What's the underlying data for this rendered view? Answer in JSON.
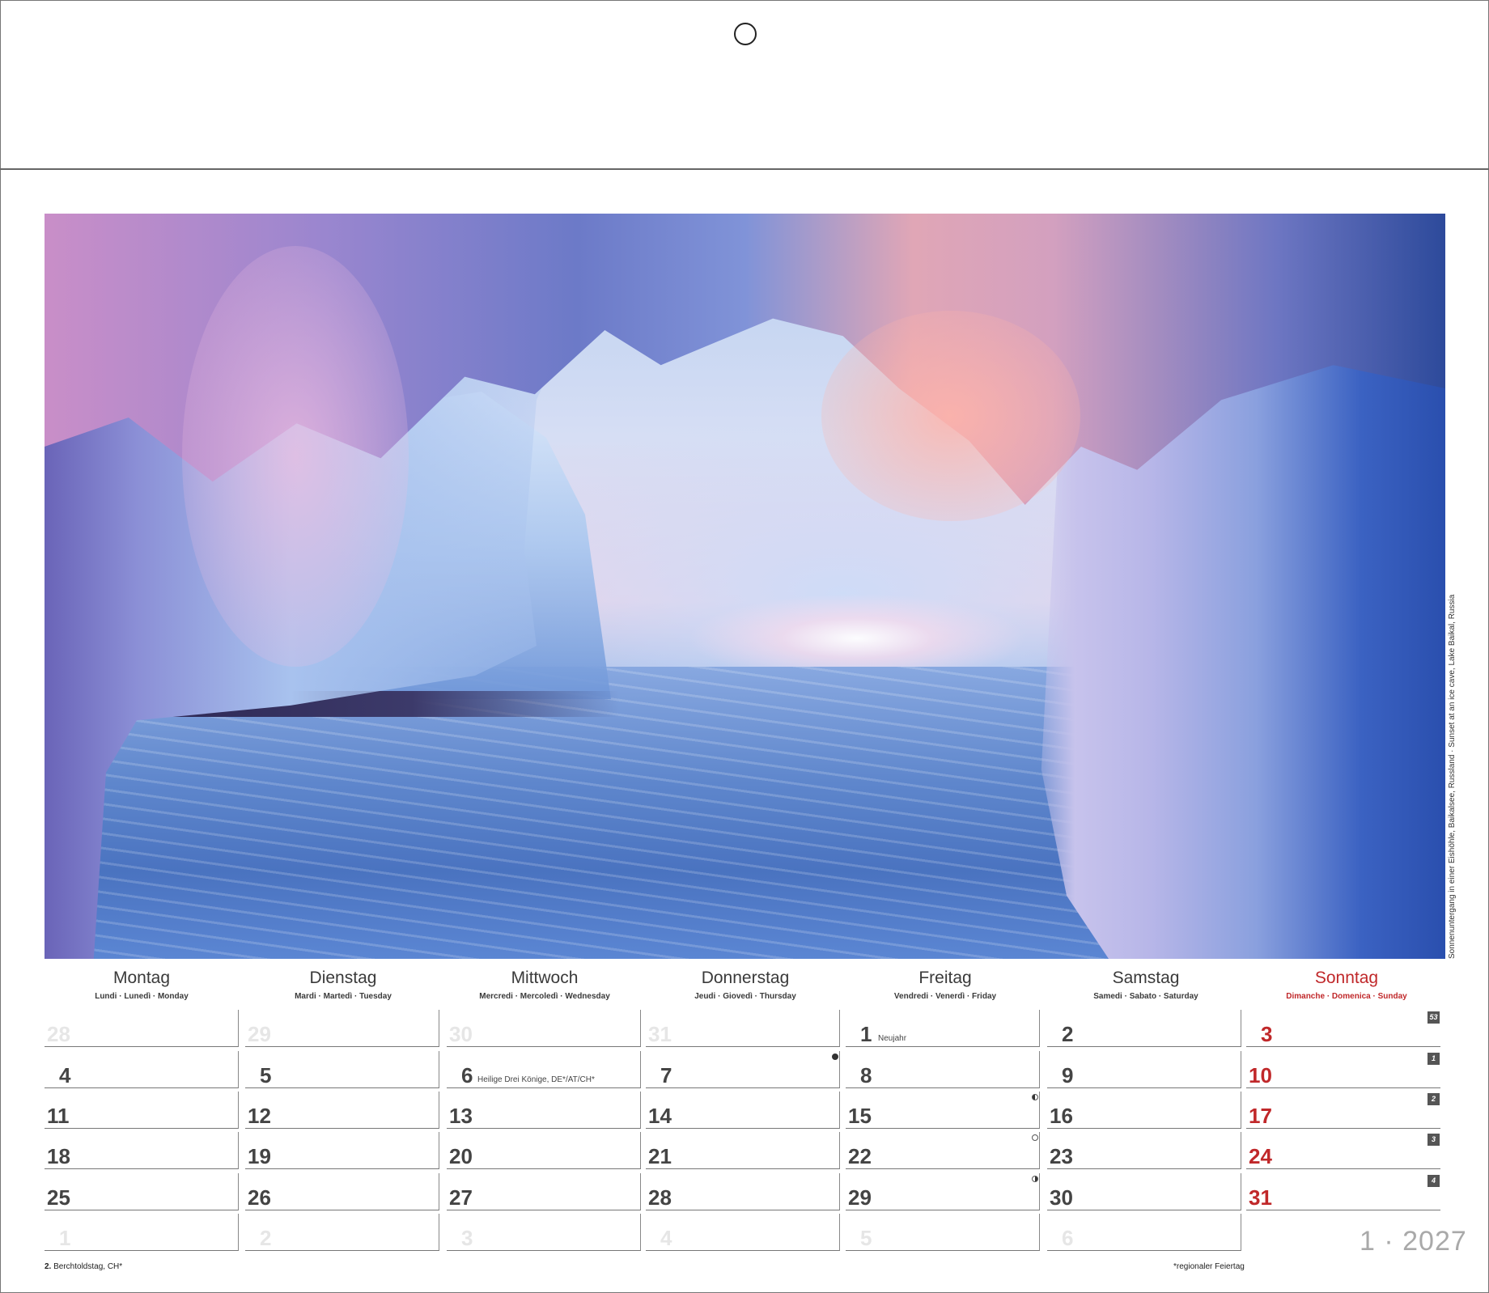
{
  "photo": {
    "caption": "Sonnenuntergang in einer Eishöhle, Baikalsee, Russland · Sunset at an ice cave, Lake Baikal, Russia"
  },
  "weekdays": [
    {
      "name": "Montag",
      "sub": "Lundi · Lunedì · Monday"
    },
    {
      "name": "Dienstag",
      "sub": "Mardi · Martedì · Tuesday"
    },
    {
      "name": "Mittwoch",
      "sub": "Mercredi · Mercoledì · Wednesday"
    },
    {
      "name": "Donnerstag",
      "sub": "Jeudi · Giovedì · Thursday"
    },
    {
      "name": "Freitag",
      "sub": "Vendredi · Venerdì · Friday"
    },
    {
      "name": "Samstag",
      "sub": "Samedi · Sabato · Saturday"
    },
    {
      "name": "Sonntag",
      "sub": "Dimanche · Domenica · Sunday"
    }
  ],
  "weeks": [
    {
      "week": "53",
      "days": [
        "28",
        "29",
        "30",
        "31",
        "1",
        "2",
        "3"
      ]
    },
    {
      "week": "1",
      "days": [
        "4",
        "5",
        "6",
        "7",
        "8",
        "9",
        "10"
      ]
    },
    {
      "week": "2",
      "days": [
        "11",
        "12",
        "13",
        "14",
        "15",
        "16",
        "17"
      ]
    },
    {
      "week": "3",
      "days": [
        "18",
        "19",
        "20",
        "21",
        "22",
        "23",
        "24"
      ]
    },
    {
      "week": "4",
      "days": [
        "25",
        "26",
        "27",
        "28",
        "29",
        "30",
        "31"
      ]
    },
    {
      "week": "",
      "days": [
        "1",
        "2",
        "3",
        "4",
        "5",
        "6",
        ""
      ]
    }
  ],
  "holidays": {
    "neujahr": "Neujahr",
    "dreikoenige": "Heilige Drei Könige, DE*/AT/CH*"
  },
  "footer": {
    "left_day": "2.",
    "left_text": "Berchtoldstag, CH*",
    "right_text": "*regionaler Feiertag"
  },
  "month_label": "1 · 2027",
  "colors": {
    "sunday": "#c0282a",
    "text": "#3a3a3a",
    "faded": "#e6e6e6",
    "month_label": "#a9a9a9"
  }
}
